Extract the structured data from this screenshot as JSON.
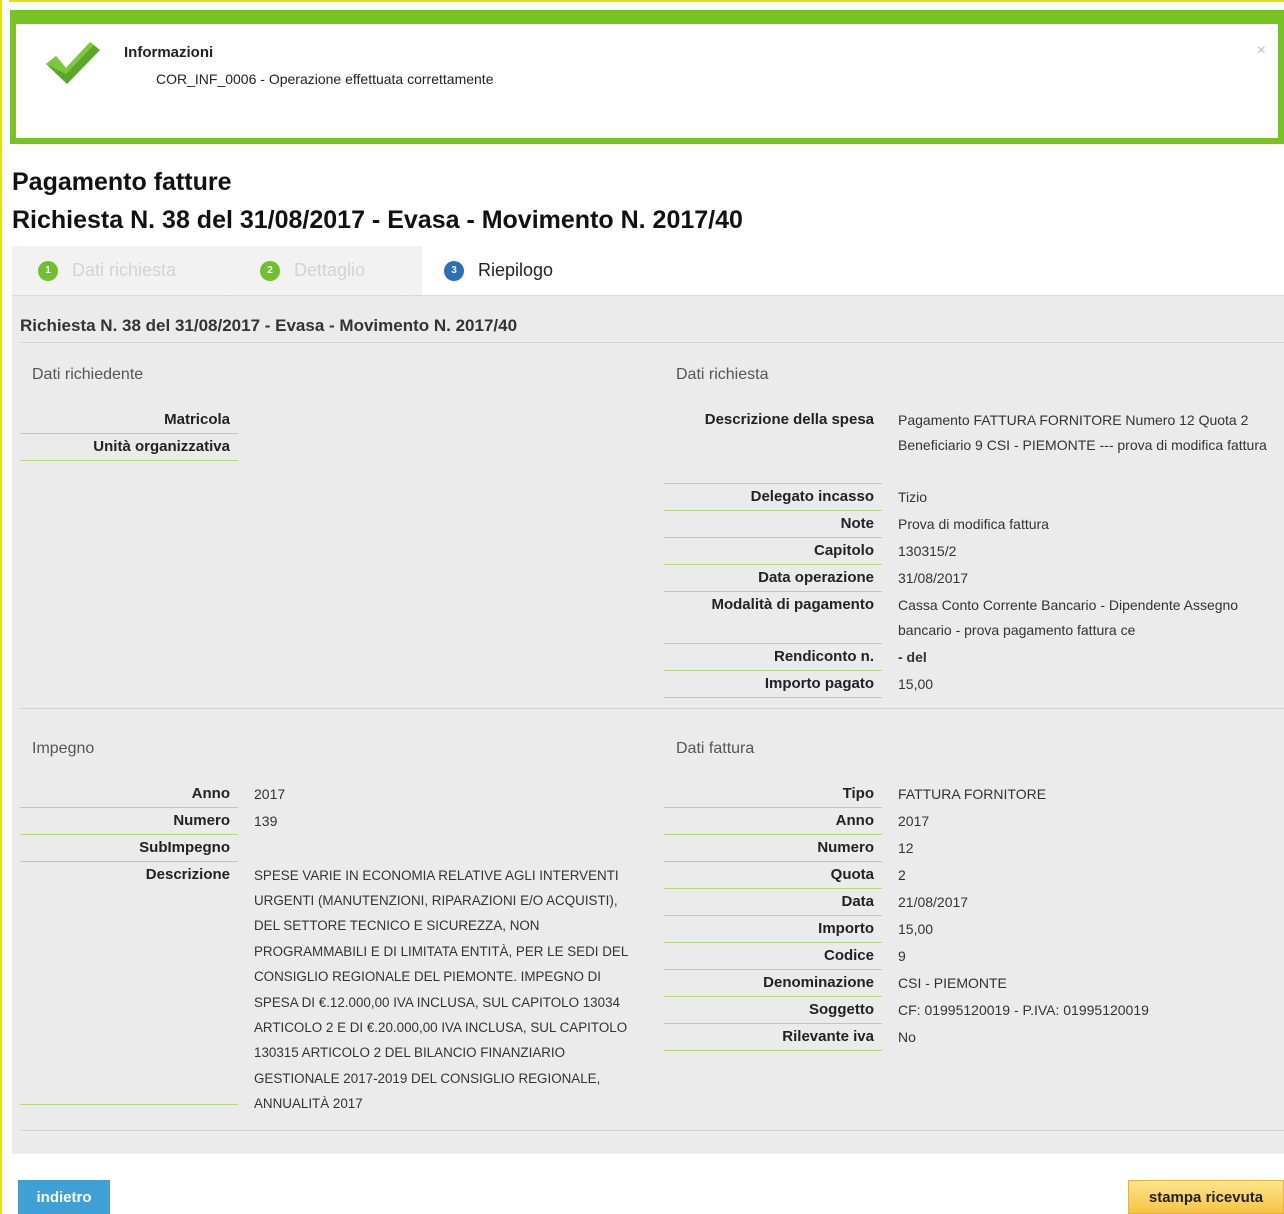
{
  "alert": {
    "title": "Informazioni",
    "message": "COR_INF_0006 - Operazione effettuata correttamente",
    "close": "×",
    "accent": "#77c324"
  },
  "page": {
    "title": "Pagamento fatture",
    "subtitle": "Richiesta N. 38 del 31/08/2017 - Evasa - Movimento N. 2017/40"
  },
  "steps": [
    {
      "num": "1",
      "label": "Dati richiesta"
    },
    {
      "num": "2",
      "label": "Dettaglio"
    },
    {
      "num": "3",
      "label": "Riepilogo"
    }
  ],
  "panel": {
    "title": "Richiesta N. 38 del 31/08/2017 - Evasa - Movimento N. 2017/40"
  },
  "dati_richiedente": {
    "heading": "Dati richiedente",
    "rows": [
      {
        "k": "Matricola",
        "v": ""
      },
      {
        "k": "Unità organizzativa",
        "v": ""
      }
    ]
  },
  "dati_richiesta": {
    "heading": "Dati richiesta",
    "rows": [
      {
        "k": "Descrizione della spesa",
        "v": "Pagamento FATTURA FORNITORE Numero 12 Quota 2 Beneficiario 9 CSI - PIEMONTE --- prova di modifica fattura"
      },
      {
        "k": "Delegato incasso",
        "v": "Tizio"
      },
      {
        "k": "Note",
        "v": "Prova di modifica fattura"
      },
      {
        "k": "Capitolo",
        "v": "130315/2"
      },
      {
        "k": "Data operazione",
        "v": "31/08/2017"
      },
      {
        "k": "Modalità di pagamento",
        "v": "Cassa Conto Corrente Bancario - Dipendente Assegno bancario - prova pagamento fattura ce"
      },
      {
        "k": "Rendiconto n.",
        "v": "- del"
      },
      {
        "k": "Importo pagato",
        "v": "15,00"
      }
    ]
  },
  "impegno": {
    "heading": "Impegno",
    "rows": [
      {
        "k": "Anno",
        "v": "2017"
      },
      {
        "k": "Numero",
        "v": "139"
      },
      {
        "k": "SubImpegno",
        "v": ""
      },
      {
        "k": "Descrizione",
        "v": "SPESE VARIE IN ECONOMIA RELATIVE AGLI INTERVENTI URGENTI (MANUTENZIONI, RIPARAZIONI E/O ACQUISTI), DEL SETTORE TECNICO E SICUREZZA, NON PROGRAMMABILI E DI LIMITATA ENTITÀ, PER LE SEDI DEL CONSIGLIO REGIONALE DEL PIEMONTE. IMPEGNO DI SPESA DI €.12.000,00 IVA INCLUSA, SUL CAPITOLO 13034 ARTICOLO 2 E DI €.20.000,00 IVA INCLUSA, SUL CAPITOLO 130315 ARTICOLO 2 DEL BILANCIO FINANZIARIO GESTIONALE 2017-2019 DEL CONSIGLIO REGIONALE, ANNUALITÀ 2017"
      }
    ]
  },
  "dati_fattura": {
    "heading": "Dati fattura",
    "rows": [
      {
        "k": "Tipo",
        "v": "FATTURA FORNITORE"
      },
      {
        "k": "Anno",
        "v": "2017"
      },
      {
        "k": "Numero",
        "v": "12"
      },
      {
        "k": "Quota",
        "v": "2"
      },
      {
        "k": "Data",
        "v": "21/08/2017"
      },
      {
        "k": "Importo",
        "v": "15,00"
      },
      {
        "k": "Codice",
        "v": "9"
      },
      {
        "k": "Denominazione",
        "v": "CSI - PIEMONTE"
      },
      {
        "k": "Soggetto",
        "v": "CF: 01995120019 - P.IVA: 01995120019"
      },
      {
        "k": "Rilevante iva",
        "v": "No"
      }
    ]
  },
  "buttons": {
    "back": "indietro",
    "print": "stampa ricevuta"
  }
}
